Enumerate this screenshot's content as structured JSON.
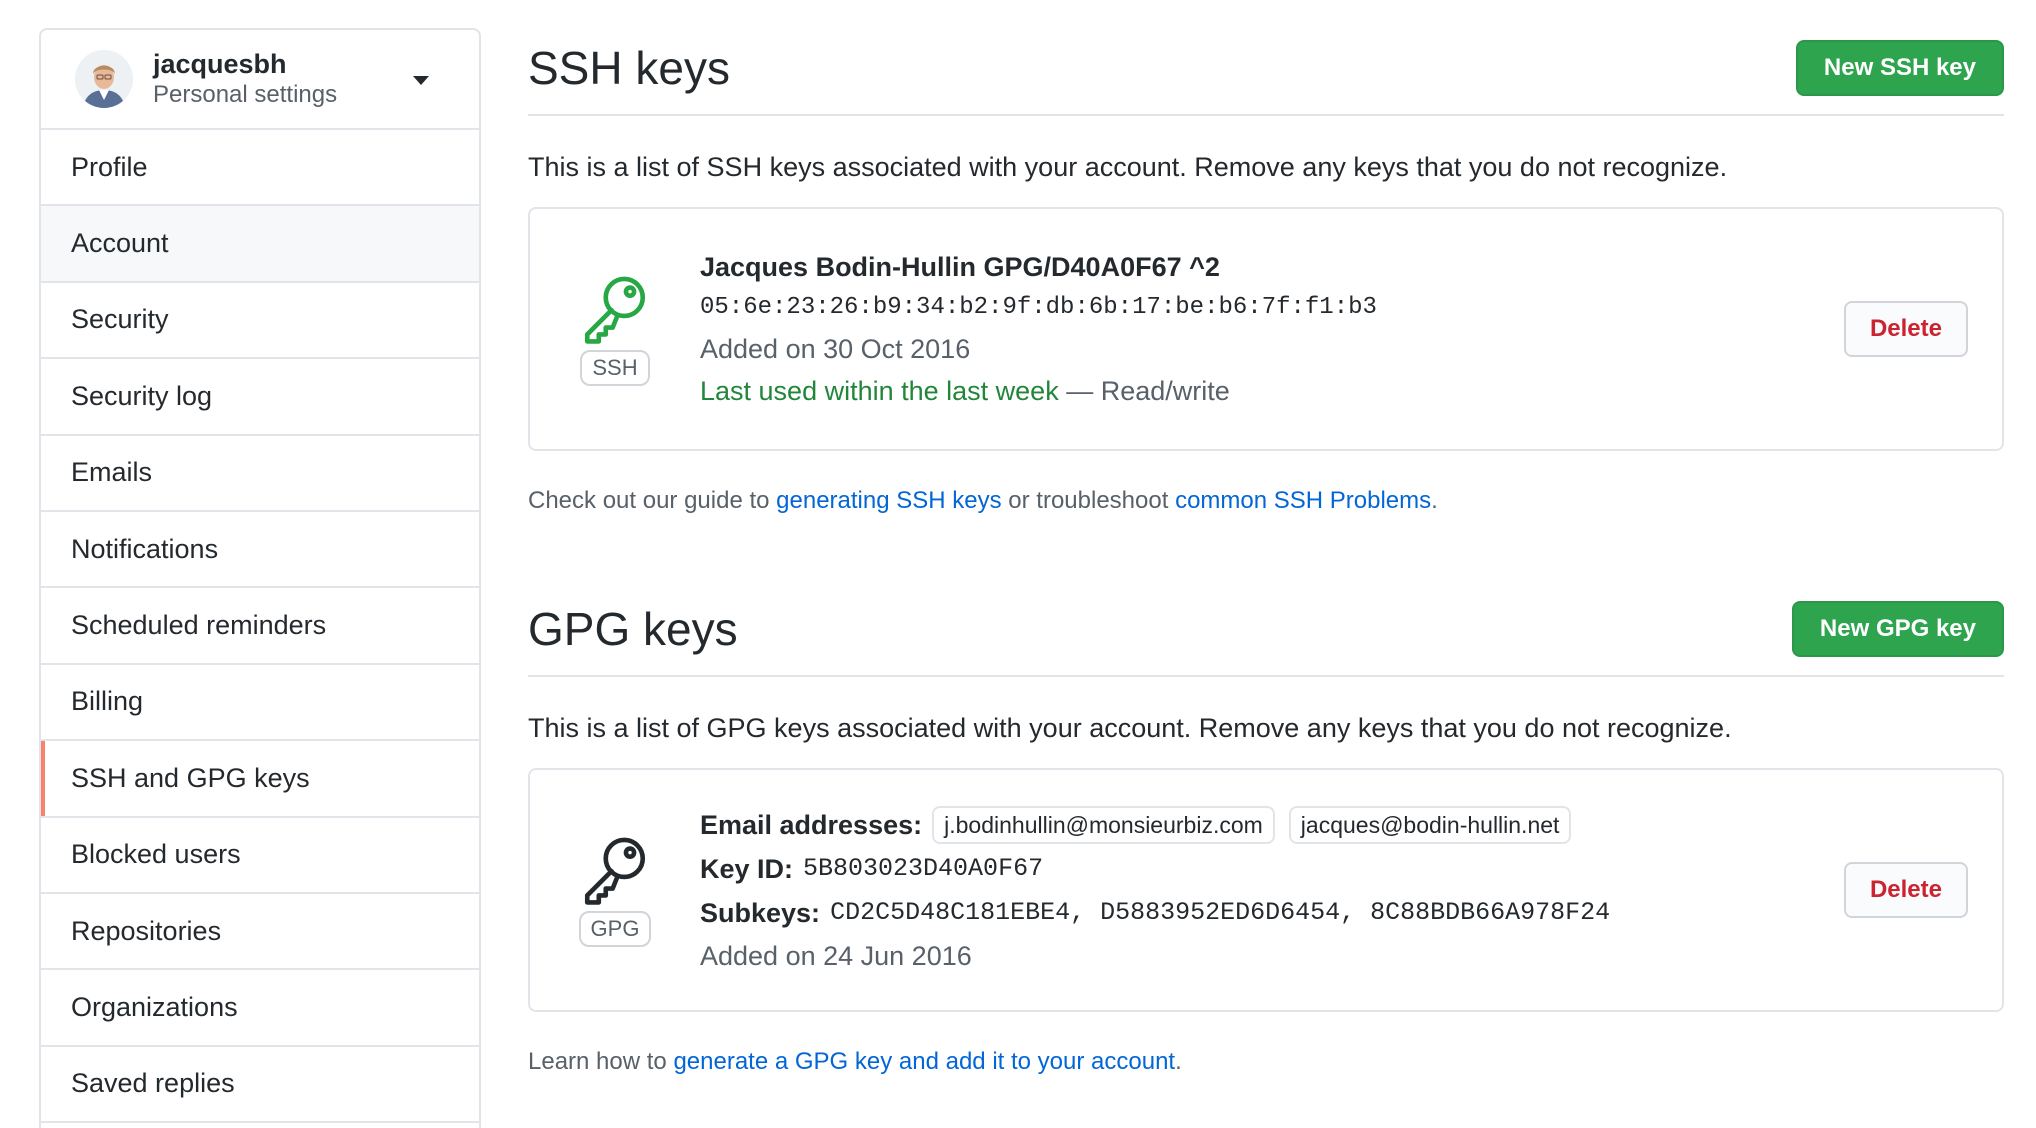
{
  "sidebar": {
    "username": "jacquesbh",
    "subtitle": "Personal settings",
    "items": [
      {
        "label": "Profile"
      },
      {
        "label": "Account"
      },
      {
        "label": "Security"
      },
      {
        "label": "Security log"
      },
      {
        "label": "Emails"
      },
      {
        "label": "Notifications"
      },
      {
        "label": "Scheduled reminders"
      },
      {
        "label": "Billing"
      },
      {
        "label": "SSH and GPG keys"
      },
      {
        "label": "Blocked users"
      },
      {
        "label": "Repositories"
      },
      {
        "label": "Organizations"
      },
      {
        "label": "Saved replies"
      }
    ]
  },
  "ssh": {
    "title": "SSH keys",
    "new_button": "New SSH key",
    "description": "This is a list of SSH keys associated with your account. Remove any keys that you do not recognize.",
    "key": {
      "badge": "SSH",
      "name": "Jacques Bodin-Hullin GPG/D40A0F67 ^2",
      "fingerprint": "05:6e:23:26:b9:34:b2:9f:db:6b:17:be:b6:7f:f1:b3",
      "added": "Added on 30 Oct 2016",
      "last_used": "Last used within the last week",
      "access": " — Read/write",
      "delete_label": "Delete"
    },
    "footnote": {
      "prefix": "Check out our guide to ",
      "link1": "generating SSH keys",
      "middle": " or troubleshoot ",
      "link2": "common SSH Problems",
      "suffix": "."
    }
  },
  "gpg": {
    "title": "GPG keys",
    "new_button": "New GPG key",
    "description": "This is a list of GPG keys associated with your account. Remove any keys that you do not recognize.",
    "key": {
      "badge": "GPG",
      "emails_label": "Email addresses:",
      "emails": [
        "j.bodinhullin@monsieurbiz.com",
        "jacques@bodin-hullin.net"
      ],
      "key_id_label": "Key ID:",
      "key_id": "5B803023D40A0F67",
      "subkeys_label": "Subkeys:",
      "subkeys": "CD2C5D48C181EBE4, D5883952ED6D6454, 8C88BDB66A978F24",
      "added": "Added on 24 Jun 2016",
      "delete_label": "Delete"
    },
    "footnote": {
      "prefix": "Learn how to ",
      "link": "generate a GPG key and add it to your account",
      "suffix": "."
    }
  },
  "colors": {
    "accent_green": "#2ea44f",
    "danger": "#cb2431",
    "link": "#0366d6",
    "selected_marker": "#f9826c"
  }
}
